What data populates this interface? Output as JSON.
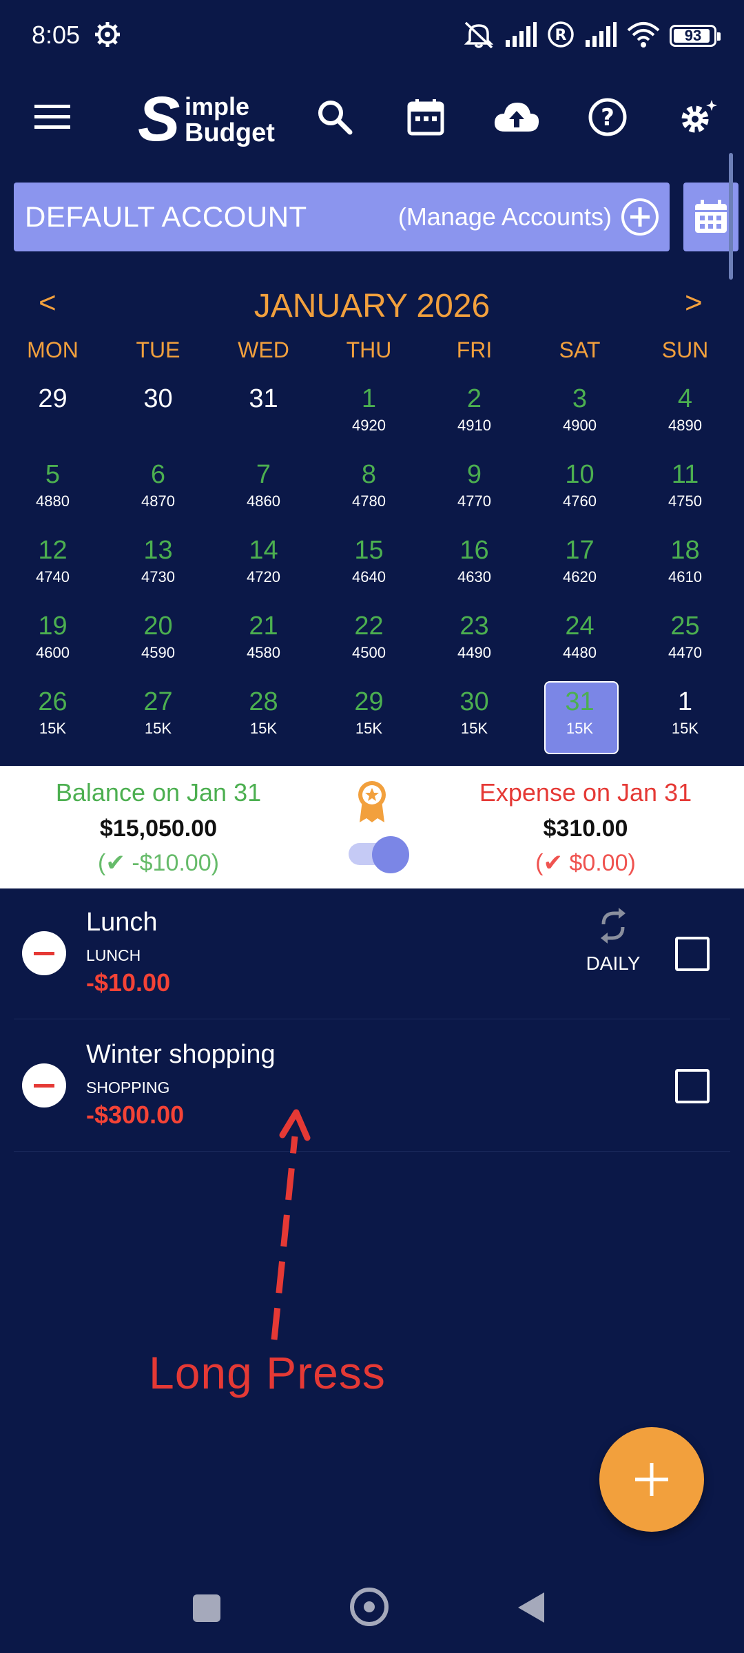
{
  "status_bar": {
    "time": "8:05",
    "battery": "93",
    "battery_level": 0.93
  },
  "app_bar": {
    "logo_line1": "imple",
    "logo_line2": "Budget",
    "logo_initial": "S",
    "icons": [
      "menu-icon",
      "search-icon",
      "calendar-icon",
      "cloud-upload-icon",
      "help-icon",
      "settings-icon"
    ]
  },
  "account": {
    "name": "DEFAULT ACCOUNT",
    "manage_label": "(Manage Accounts)"
  },
  "calendar": {
    "prev": "<",
    "next": ">",
    "month_title": "JANUARY 2026",
    "weekdays": [
      "MON",
      "TUE",
      "WED",
      "THU",
      "FRI",
      "SAT",
      "SUN"
    ],
    "weeks": [
      [
        {
          "d": "29",
          "b": "",
          "cur": false
        },
        {
          "d": "30",
          "b": "",
          "cur": false
        },
        {
          "d": "31",
          "b": "",
          "cur": false
        },
        {
          "d": "1",
          "b": "4920",
          "cur": true
        },
        {
          "d": "2",
          "b": "4910",
          "cur": true
        },
        {
          "d": "3",
          "b": "4900",
          "cur": true
        },
        {
          "d": "4",
          "b": "4890",
          "cur": true
        }
      ],
      [
        {
          "d": "5",
          "b": "4880",
          "cur": true
        },
        {
          "d": "6",
          "b": "4870",
          "cur": true
        },
        {
          "d": "7",
          "b": "4860",
          "cur": true
        },
        {
          "d": "8",
          "b": "4780",
          "cur": true
        },
        {
          "d": "9",
          "b": "4770",
          "cur": true
        },
        {
          "d": "10",
          "b": "4760",
          "cur": true
        },
        {
          "d": "11",
          "b": "4750",
          "cur": true
        }
      ],
      [
        {
          "d": "12",
          "b": "4740",
          "cur": true
        },
        {
          "d": "13",
          "b": "4730",
          "cur": true
        },
        {
          "d": "14",
          "b": "4720",
          "cur": true
        },
        {
          "d": "15",
          "b": "4640",
          "cur": true
        },
        {
          "d": "16",
          "b": "4630",
          "cur": true
        },
        {
          "d": "17",
          "b": "4620",
          "cur": true
        },
        {
          "d": "18",
          "b": "4610",
          "cur": true
        }
      ],
      [
        {
          "d": "19",
          "b": "4600",
          "cur": true
        },
        {
          "d": "20",
          "b": "4590",
          "cur": true
        },
        {
          "d": "21",
          "b": "4580",
          "cur": true
        },
        {
          "d": "22",
          "b": "4500",
          "cur": true
        },
        {
          "d": "23",
          "b": "4490",
          "cur": true
        },
        {
          "d": "24",
          "b": "4480",
          "cur": true
        },
        {
          "d": "25",
          "b": "4470",
          "cur": true
        }
      ],
      [
        {
          "d": "26",
          "b": "15K",
          "cur": true
        },
        {
          "d": "27",
          "b": "15K",
          "cur": true
        },
        {
          "d": "28",
          "b": "15K",
          "cur": true
        },
        {
          "d": "29",
          "b": "15K",
          "cur": true
        },
        {
          "d": "30",
          "b": "15K",
          "cur": true
        },
        {
          "d": "31",
          "b": "15K",
          "cur": true,
          "selected": true
        },
        {
          "d": "1",
          "b": "15K",
          "cur": false
        }
      ]
    ]
  },
  "summary": {
    "balance_title": "Balance on Jan 31",
    "balance_amount": "$15,050.00",
    "balance_change": "-$10.00",
    "expense_title": "Expense on Jan 31",
    "expense_amount": "$310.00",
    "expense_change": "$0.00"
  },
  "transactions": [
    {
      "title": "Lunch",
      "category": "LUNCH",
      "amount": "-$10.00",
      "recurrence": "DAILY"
    },
    {
      "title": "Winter shopping",
      "category": "SHOPPING",
      "amount": "-$300.00",
      "recurrence": ""
    }
  ],
  "annotation": {
    "text": "Long Press"
  },
  "colors": {
    "background": "#0b1848",
    "accent_orange": "#f2a03d",
    "account_bar": "#8b95ee",
    "income_green": "#4caf50",
    "expense_red": "#e53935"
  }
}
